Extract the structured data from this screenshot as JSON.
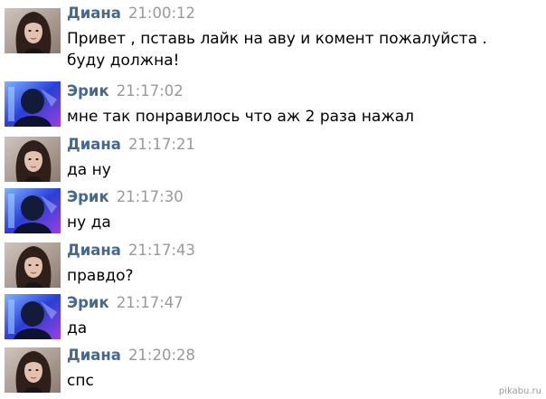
{
  "messages": [
    {
      "author": "Диана",
      "time": "21:00:12",
      "text": "Привет , пставь лайк на аву и комент пожалуйста . буду должна!",
      "avatar": "diana-avatar"
    },
    {
      "author": "Эрик",
      "time": "21:17:02",
      "text": "мне так понравилось что аж 2 раза нажал",
      "avatar": "erik-avatar"
    },
    {
      "author": "Диана",
      "time": "21:17:21",
      "text": "да ну",
      "avatar": "diana-avatar"
    },
    {
      "author": "Эрик",
      "time": "21:17:30",
      "text": "ну да",
      "avatar": "erik-avatar"
    },
    {
      "author": "Диана",
      "time": "21:17:43",
      "text": "правдо?",
      "avatar": "diana-avatar"
    },
    {
      "author": "Эрик",
      "time": "21:17:47",
      "text": "да",
      "avatar": "erik-avatar"
    },
    {
      "author": "Диана",
      "time": "21:20:28",
      "text": "спс",
      "avatar": "diana-avatar"
    }
  ],
  "watermark": "pikabu.ru",
  "colors": {
    "author": "#45688e",
    "time": "#999999",
    "text": "#000000",
    "background": "#ffffff"
  }
}
